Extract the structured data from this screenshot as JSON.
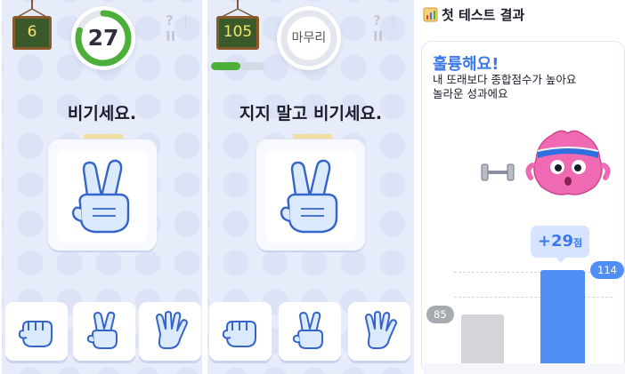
{
  "screen1": {
    "level": "6",
    "timer": "27",
    "timer_fraction": 0.8,
    "help_icon": "?",
    "pause_icon": "II",
    "instruction": "비기세요.",
    "shown_hand": "scissors",
    "choices": [
      "rock",
      "scissors",
      "paper"
    ]
  },
  "screen2": {
    "level": "105",
    "timer_label": "마무리",
    "progress_fraction": 0.55,
    "help_icon": "?",
    "pause_icon": "II",
    "instruction": "지지 말고 비기세요.",
    "shown_hand": "scissors",
    "choices": [
      "rock",
      "scissors",
      "paper"
    ]
  },
  "result": {
    "header": "첫 테스트 결과",
    "title": "훌륭해요!",
    "desc_line1": "내 또래보다 종합점수가 높아요",
    "desc_line2": "놀라운 성과에요",
    "diff_value": "+29",
    "diff_unit": "점",
    "bar_prev_value": 85,
    "bar_prev_label": "85",
    "bar_me_value": 114,
    "bar_me_label": "114",
    "colors": {
      "accent": "#3b79ec",
      "bar_prev": "#d4d5da",
      "bar_me": "#4f8ef5",
      "label_prev": "#a8aab2"
    }
  },
  "colors": {
    "board_bg": "#3b5a2c",
    "board_text": "#f5e36b",
    "timer_green": "#4caf3a"
  }
}
